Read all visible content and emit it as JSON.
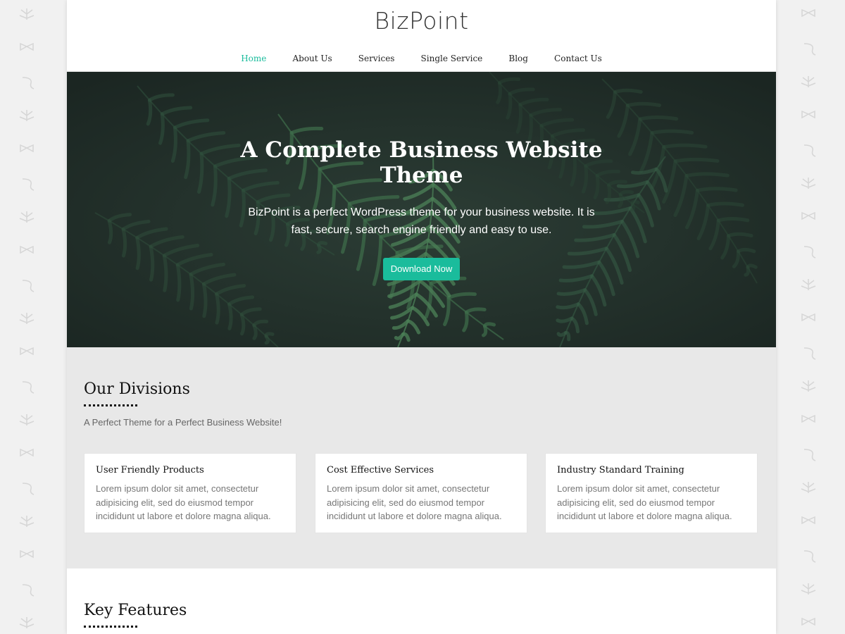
{
  "site": {
    "logo": "BizPoint",
    "nav": [
      {
        "label": "Home",
        "active": true
      },
      {
        "label": "About Us",
        "active": false
      },
      {
        "label": "Services",
        "active": false
      },
      {
        "label": "Single Service",
        "active": false
      },
      {
        "label": "Blog",
        "active": false
      },
      {
        "label": "Contact Us",
        "active": false
      }
    ]
  },
  "hero": {
    "title": "A Complete Business Website Theme",
    "subtitle": "BizPoint is a perfect WordPress theme for your business website. It is fast, secure, search engine friendly and easy to use.",
    "button_label": "Download Now"
  },
  "divisions": {
    "title": "Our Divisions",
    "subtitle": "A Perfect Theme for a Perfect Business Website!",
    "cards": [
      {
        "title": "User Friendly Products",
        "text": "Lorem ipsum dolor sit amet, consectetur adipisicing elit, sed do eiusmod tempor incididunt ut labore et dolore magna aliqua."
      },
      {
        "title": "Cost Effective Services",
        "text": "Lorem ipsum dolor sit amet, consectetur adipisicing elit, sed do eiusmod tempor incididunt ut labore et dolore magna aliqua."
      },
      {
        "title": "Industry Standard Training",
        "text": "Lorem ipsum dolor sit amet, consectetur adipisicing elit, sed do eiusmod tempor incididunt ut labore et dolore magna aliqua."
      }
    ]
  },
  "features": {
    "title": "Key Features"
  },
  "colors": {
    "accent": "#1abc9c",
    "hero_bg": "#22302b",
    "section_bg": "#e8e8e8",
    "page_bg": "#f1f1f1"
  },
  "icons": {
    "background_pattern": [
      "leaf-icon",
      "bowtie-icon",
      "pipe-icon"
    ]
  }
}
